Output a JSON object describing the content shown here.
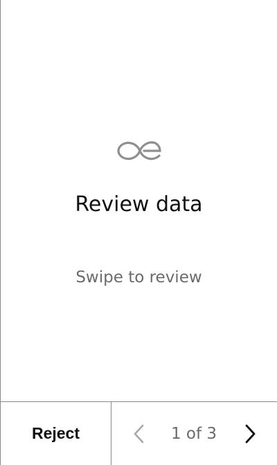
{
  "main": {
    "logo_icon": "ae-loop-logo-icon",
    "title": "Review data",
    "subtitle": "Swipe to review"
  },
  "footer": {
    "reject_label": "Reject",
    "page_indicator": "1 of 3",
    "prev_icon": "chevron-left-icon",
    "next_icon": "chevron-right-icon"
  },
  "colors": {
    "text_primary": "#111111",
    "text_secondary": "#6b6b6b",
    "divider": "#8a8a8a",
    "icon_disabled": "#a8a8a8",
    "icon_active": "#111111"
  }
}
